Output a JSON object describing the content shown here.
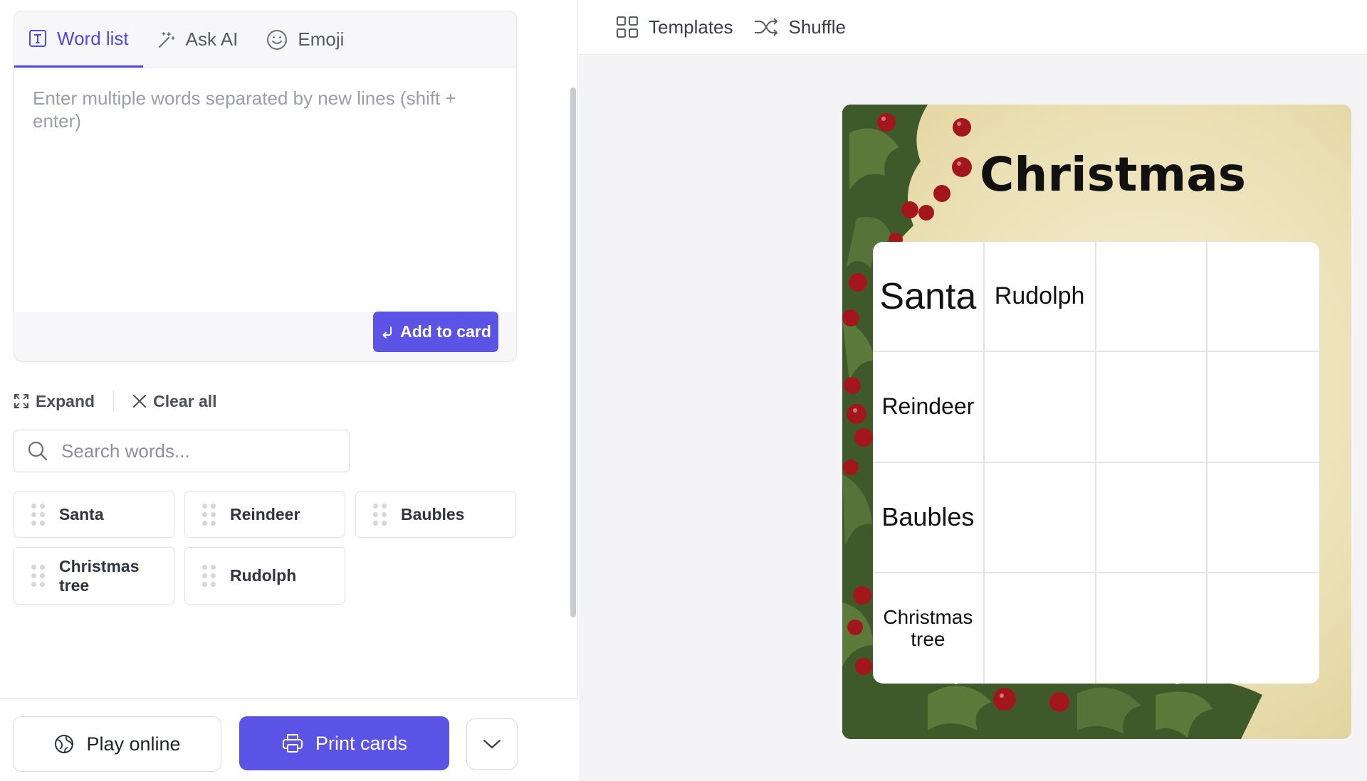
{
  "editor": {
    "tabs": [
      {
        "label": "Word list",
        "icon": "text-icon",
        "active": true
      },
      {
        "label": "Ask AI",
        "icon": "magic-wand-icon",
        "active": false
      },
      {
        "label": "Emoji",
        "icon": "smiley-icon",
        "active": false
      }
    ],
    "textarea_placeholder": "Enter multiple words separated by new lines (shift + enter)",
    "textarea_value": "",
    "add_button": "Add to card"
  },
  "word_actions": {
    "expand": "Expand",
    "clear_all": "Clear all"
  },
  "search": {
    "placeholder": "Search words..."
  },
  "words": [
    "Santa",
    "Reindeer",
    "Baubles",
    "Christmas tree",
    "Rudolph"
  ],
  "footer": {
    "play_online": "Play online",
    "print_cards": "Print cards"
  },
  "toolbar": {
    "templates": "Templates",
    "shuffle": "Shuffle"
  },
  "card": {
    "title": "Christmas",
    "theme_colors": {
      "accent": "#5b53e6",
      "card_bg": "#ebe1b6",
      "holly_green": "#3f5a2a",
      "berry_red": "#a3161c"
    },
    "grid": [
      [
        "Santa",
        "Rudolph",
        "",
        ""
      ],
      [
        "Reindeer",
        "",
        "",
        ""
      ],
      [
        "Baubles",
        "",
        "",
        ""
      ],
      [
        "Christmas tree",
        "",
        "",
        ""
      ]
    ]
  }
}
